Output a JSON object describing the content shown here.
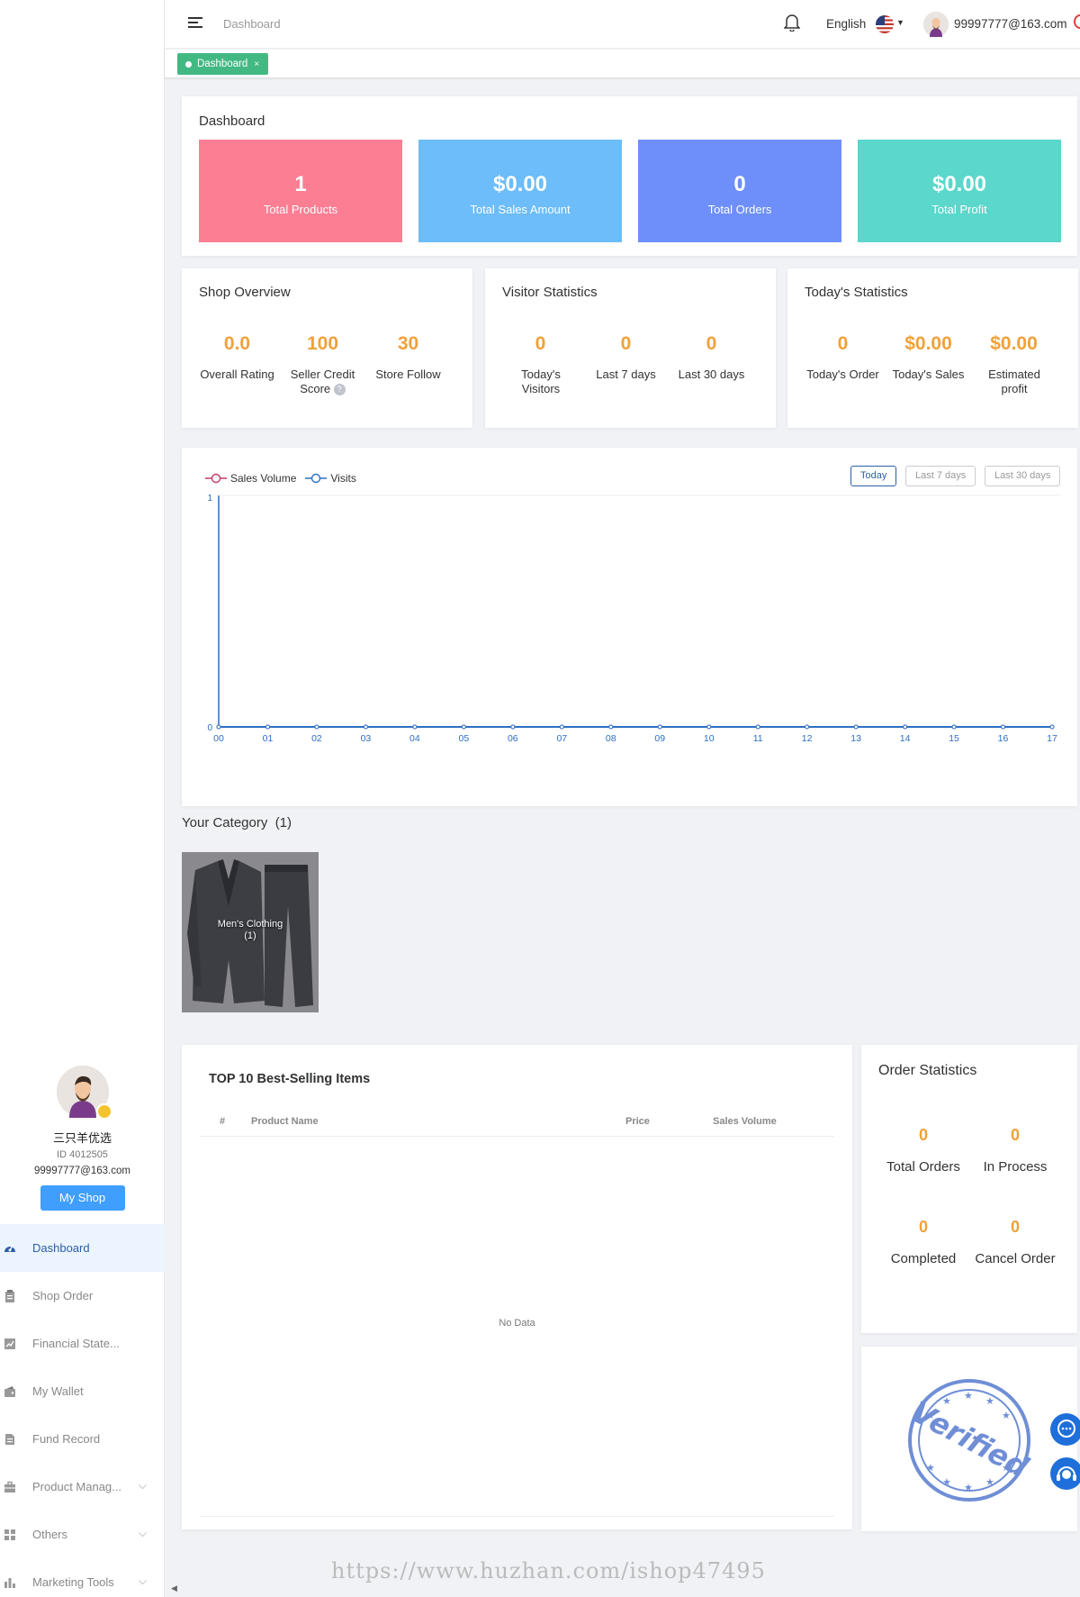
{
  "header": {
    "breadcrumb": "Dashboard",
    "language": "English",
    "user_email": "99997777@163.com"
  },
  "tags": [
    {
      "label": "Dashboard",
      "close": "×"
    }
  ],
  "dashboard": {
    "title": "Dashboard",
    "tiles": [
      {
        "value": "1",
        "label": "Total Products",
        "color": "#fb7e93"
      },
      {
        "value": "$0.00",
        "label": "Total Sales Amount",
        "color": "#6cbdf9"
      },
      {
        "value": "0",
        "label": "Total Orders",
        "color": "#6e8ff9"
      },
      {
        "value": "$0.00",
        "label": "Total Profit",
        "color": "#5bd7cb"
      }
    ]
  },
  "shop_overview": {
    "title": "Shop Overview",
    "items": [
      {
        "value": "0.0",
        "label": "Overall Rating"
      },
      {
        "value": "100",
        "label": "Seller Credit Score"
      },
      {
        "value": "30",
        "label": "Store Follow"
      }
    ],
    "help_icon": "?"
  },
  "visitor_statistics": {
    "title": "Visitor Statistics",
    "items": [
      {
        "value": "0",
        "label": "Today's Visitors"
      },
      {
        "value": "0",
        "label": "Last 7 days"
      },
      {
        "value": "0",
        "label": "Last 30 days"
      }
    ]
  },
  "todays_statistics": {
    "title": "Today's Statistics",
    "items": [
      {
        "value": "0",
        "label": "Today's Order"
      },
      {
        "value": "$0.00",
        "label": "Today's Sales"
      },
      {
        "value": "$0.00",
        "label": "Estimated profit"
      }
    ]
  },
  "chart_data": {
    "type": "line",
    "x": [
      "00",
      "01",
      "02",
      "03",
      "04",
      "05",
      "06",
      "07",
      "08",
      "09",
      "10",
      "11",
      "12",
      "13",
      "14",
      "15",
      "16",
      "17"
    ],
    "series": [
      {
        "name": "Sales Volume",
        "values": [
          0,
          0,
          0,
          0,
          0,
          0,
          0,
          0,
          0,
          0,
          0,
          0,
          0,
          0,
          0,
          0,
          0,
          0
        ],
        "color": "#c23a5f"
      },
      {
        "name": "Visits",
        "values": [
          0,
          0,
          0,
          0,
          0,
          0,
          0,
          0,
          0,
          0,
          0,
          0,
          0,
          0,
          0,
          0,
          0,
          0
        ],
        "color": "#2c6fc2"
      }
    ],
    "ylim": [
      0,
      1
    ],
    "yticks": [
      "0",
      "1"
    ],
    "grid": false,
    "legend": "top-left"
  },
  "chart_ranges": [
    "Today",
    "Last 7 days",
    "Last 30 days"
  ],
  "category": {
    "title": "Your Category",
    "count": "(1)",
    "items": [
      {
        "name": "Men's Clothing",
        "count": "(1)"
      }
    ]
  },
  "top_items": {
    "title": "TOP 10 Best-Selling Items",
    "columns": [
      "#",
      "Product Name",
      "Price",
      "Sales Volume"
    ],
    "empty_text": "No Data"
  },
  "order_statistics": {
    "title": "Order Statistics",
    "items": [
      {
        "value": "0",
        "label": "Total Orders"
      },
      {
        "value": "0",
        "label": "In Process"
      },
      {
        "value": "0",
        "label": "Completed"
      },
      {
        "value": "0",
        "label": "Cancel Order"
      }
    ]
  },
  "verified_stamp": "Verified",
  "profile": {
    "name": "三只羊优选",
    "id": "ID 4012505",
    "email": "99997777@163.com",
    "button": "My Shop"
  },
  "menu": [
    {
      "label": "Dashboard",
      "icon": "dashboard-icon",
      "active": true
    },
    {
      "label": "Shop Order",
      "icon": "clipboard-icon"
    },
    {
      "label": "Financial State...",
      "icon": "chart-icon"
    },
    {
      "label": "My Wallet",
      "icon": "wallet-icon"
    },
    {
      "label": "Fund Record",
      "icon": "document-icon"
    },
    {
      "label": "Product Manag...",
      "icon": "briefcase-icon",
      "expandable": true
    },
    {
      "label": "Others",
      "icon": "grid-icon",
      "expandable": true
    },
    {
      "label": "Marketing Tools",
      "icon": "bar-chart-icon",
      "expandable": true
    }
  ],
  "watermark": "https://www.huzhan.com/ishop47495"
}
